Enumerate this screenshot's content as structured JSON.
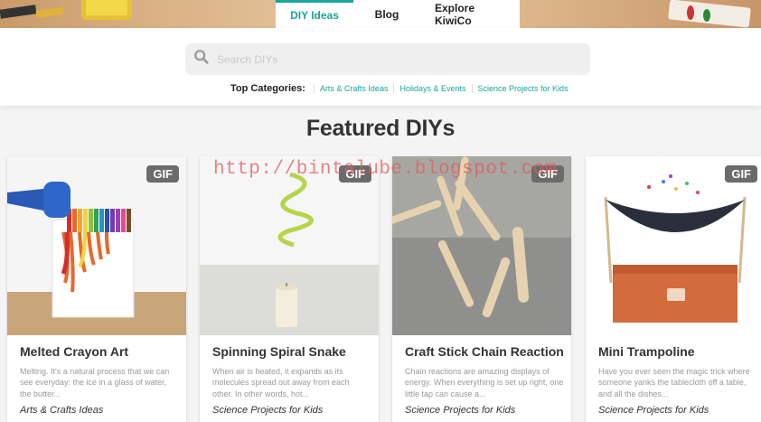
{
  "nav": {
    "tabs": [
      {
        "label": "DIY Ideas",
        "active": true
      },
      {
        "label": "Blog",
        "active": false
      },
      {
        "label": "Explore KiwiCo",
        "active": false
      }
    ]
  },
  "search": {
    "placeholder": "Search DIYs"
  },
  "categories": {
    "label": "Top Categories:",
    "items": [
      "Arts & Crafts Ideas",
      "Holidays & Events",
      "Science Projects for Kids"
    ]
  },
  "section": {
    "title": "Featured DIYs"
  },
  "watermark": "http://bintalube.blogspot.com",
  "cards": [
    {
      "badge": "GIF",
      "title": "Melted Crayon Art",
      "description": "Melting. It's a natural process that we can see everyday: the ice in a glass of water, the butter...",
      "category": "Arts & Crafts Ideas"
    },
    {
      "badge": "GIF",
      "title": "Spinning Spiral Snake",
      "description": "When air is heated, it expands as its molecules spread out away from each other. In other words, hot...",
      "category": "Science Projects for Kids"
    },
    {
      "badge": "GIF",
      "title": "Craft Stick Chain Reaction",
      "description": "Chain reactions are amazing displays of energy. When everything is set up right, one little tap can cause a...",
      "category": "Science Projects for Kids"
    },
    {
      "badge": "GIF",
      "title": "Mini Trampoline",
      "description": "Have you ever seen the magic trick where someone yanks the tablecloth off a table, and all the dishes...",
      "category": "Science Projects for Kids"
    }
  ],
  "colors": {
    "accent": "#1aa39b",
    "badge": "#6b6b6b"
  }
}
